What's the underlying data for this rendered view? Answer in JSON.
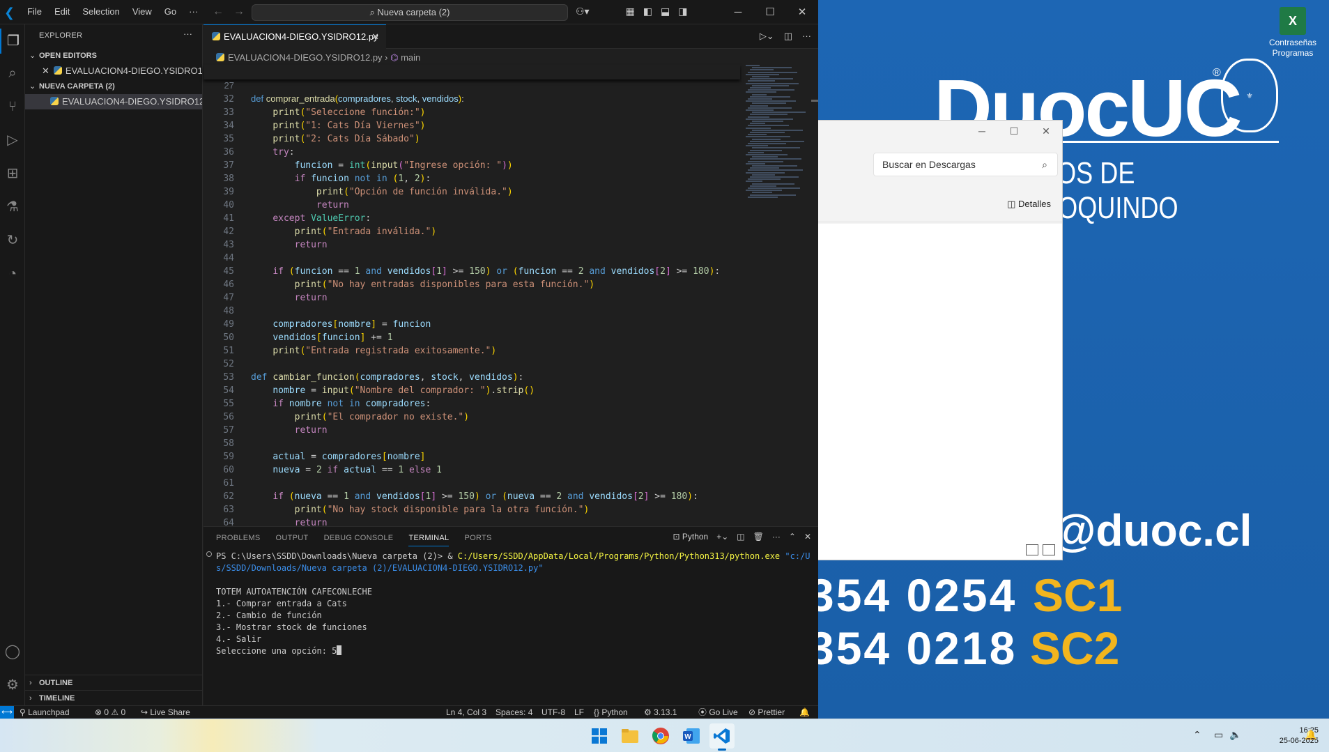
{
  "desktop": {
    "logo_text": "DuocUC",
    "subtitle": "RLOS DE APOQUINDO",
    "email": "@duoc.cl",
    "phone1": "354 0254",
    "code1": "SC1",
    "phone2": "354 0218",
    "code2": "SC2",
    "icon_label": "Contraseñas Programas",
    "icon_name": "excel-file-icon"
  },
  "file_explorer": {
    "search_placeholder": "Buscar en Descargas",
    "details_label": "Detalles"
  },
  "vscode": {
    "menu": [
      "File",
      "Edit",
      "Selection",
      "View",
      "Go",
      "···"
    ],
    "command_center": "Nueva carpeta (2)",
    "explorer_title": "EXPLORER",
    "open_editors_label": "OPEN EDITORS",
    "open_editor_file": "EVALUACION4-DIEGO.YSIDRO12.py",
    "folder_label": "NUEVA CARPETA (2)",
    "folder_file": "EVALUACION4-DIEGO.YSIDRO12.py",
    "outline_label": "OUTLINE",
    "timeline_label": "TIMELINE",
    "tab_label": "EVALUACION4-DIEGO.YSIDRO12.py",
    "breadcrumb_file": "EVALUACION4-DIEGO.YSIDRO12.py",
    "breadcrumb_symbol": "main",
    "sticky_line": {
      "n": "27",
      "html": "<span class='kw2'>def</span> <span class='fn'>comprar_entrada</span><span class='br'>(</span><span class='vr'>compradores</span>, <span class='vr'>stock</span>, <span class='vr'>vendidos</span><span class='br'>)</span>:"
    },
    "code_lines": [
      {
        "n": "32",
        "html": ""
      },
      {
        "n": "33",
        "html": "    <span class='fn'>print</span><span class='br'>(</span><span class='st'>\"Seleccione función:\"</span><span class='br'>)</span>"
      },
      {
        "n": "34",
        "html": "    <span class='fn'>print</span><span class='br'>(</span><span class='st'>\"1: Cats Día Viernes\"</span><span class='br'>)</span>"
      },
      {
        "n": "35",
        "html": "    <span class='fn'>print</span><span class='br'>(</span><span class='st'>\"2: Cats Día Sábado\"</span><span class='br'>)</span>"
      },
      {
        "n": "36",
        "html": "    <span class='kw'>try</span>:"
      },
      {
        "n": "37",
        "html": "        <span class='vr'>funcion</span> = <span class='ty'>int</span><span class='br'>(</span><span class='fn'>input</span><span class='br2'>(</span><span class='st'>\"Ingrese opción: \"</span><span class='br2'>)</span><span class='br'>)</span>"
      },
      {
        "n": "38",
        "html": "        <span class='kw'>if</span> <span class='vr'>funcion</span> <span class='kw2'>not in</span> <span class='br'>(</span><span class='nm'>1</span>, <span class='nm'>2</span><span class='br'>)</span>:"
      },
      {
        "n": "39",
        "html": "            <span class='fn'>print</span><span class='br'>(</span><span class='st'>\"Opción de función inválida.\"</span><span class='br'>)</span>"
      },
      {
        "n": "40",
        "html": "            <span class='kw'>return</span>"
      },
      {
        "n": "41",
        "html": "    <span class='kw'>except</span> <span class='ty'>ValueError</span>:"
      },
      {
        "n": "42",
        "html": "        <span class='fn'>print</span><span class='br'>(</span><span class='st'>\"Entrada inválida.\"</span><span class='br'>)</span>"
      },
      {
        "n": "43",
        "html": "        <span class='kw'>return</span>"
      },
      {
        "n": "44",
        "html": ""
      },
      {
        "n": "45",
        "html": "    <span class='kw'>if</span> <span class='br'>(</span><span class='vr'>funcion</span> == <span class='nm'>1</span> <span class='kw2'>and</span> <span class='vr'>vendidos</span><span class='br2'>[</span><span class='nm'>1</span><span class='br2'>]</span> >= <span class='nm'>150</span><span class='br'>)</span> <span class='kw2'>or</span> <span class='br'>(</span><span class='vr'>funcion</span> == <span class='nm'>2</span> <span class='kw2'>and</span> <span class='vr'>vendidos</span><span class='br2'>[</span><span class='nm'>2</span><span class='br2'>]</span> >= <span class='nm'>180</span><span class='br'>)</span>:"
      },
      {
        "n": "46",
        "html": "        <span class='fn'>print</span><span class='br'>(</span><span class='st'>\"No hay entradas disponibles para esta función.\"</span><span class='br'>)</span>"
      },
      {
        "n": "47",
        "html": "        <span class='kw'>return</span>"
      },
      {
        "n": "48",
        "html": ""
      },
      {
        "n": "49",
        "html": "    <span class='vr'>compradores</span><span class='br'>[</span><span class='vr'>nombre</span><span class='br'>]</span> = <span class='vr'>funcion</span>"
      },
      {
        "n": "50",
        "html": "    <span class='vr'>vendidos</span><span class='br'>[</span><span class='vr'>funcion</span><span class='br'>]</span> += <span class='nm'>1</span>"
      },
      {
        "n": "51",
        "html": "    <span class='fn'>print</span><span class='br'>(</span><span class='st'>\"Entrada registrada exitosamente.\"</span><span class='br'>)</span>"
      },
      {
        "n": "52",
        "html": ""
      },
      {
        "n": "53",
        "html": "<span class='kw2'>def</span> <span class='fn'>cambiar_funcion</span><span class='br'>(</span><span class='vr'>compradores</span>, <span class='vr'>stock</span>, <span class='vr'>vendidos</span><span class='br'>)</span>:"
      },
      {
        "n": "54",
        "html": "    <span class='vr'>nombre</span> = <span class='fn'>input</span><span class='br'>(</span><span class='st'>\"Nombre del comprador: \"</span><span class='br'>)</span>.<span class='fn'>strip</span><span class='br'>()</span>"
      },
      {
        "n": "55",
        "html": "    <span class='kw'>if</span> <span class='vr'>nombre</span> <span class='kw2'>not in</span> <span class='vr'>compradores</span>:"
      },
      {
        "n": "56",
        "html": "        <span class='fn'>print</span><span class='br'>(</span><span class='st'>\"El comprador no existe.\"</span><span class='br'>)</span>"
      },
      {
        "n": "57",
        "html": "        <span class='kw'>return</span>"
      },
      {
        "n": "58",
        "html": ""
      },
      {
        "n": "59",
        "html": "    <span class='vr'>actual</span> = <span class='vr'>compradores</span><span class='br'>[</span><span class='vr'>nombre</span><span class='br'>]</span>"
      },
      {
        "n": "60",
        "html": "    <span class='vr'>nueva</span> = <span class='nm'>2</span> <span class='kw'>if</span> <span class='vr'>actual</span> == <span class='nm'>1</span> <span class='kw'>else</span> <span class='nm'>1</span>"
      },
      {
        "n": "61",
        "html": ""
      },
      {
        "n": "62",
        "html": "    <span class='kw'>if</span> <span class='br'>(</span><span class='vr'>nueva</span> == <span class='nm'>1</span> <span class='kw2'>and</span> <span class='vr'>vendidos</span><span class='br2'>[</span><span class='nm'>1</span><span class='br2'>]</span> >= <span class='nm'>150</span><span class='br'>)</span> <span class='kw2'>or</span> <span class='br'>(</span><span class='vr'>nueva</span> == <span class='nm'>2</span> <span class='kw2'>and</span> <span class='vr'>vendidos</span><span class='br2'>[</span><span class='nm'>2</span><span class='br2'>]</span> >= <span class='nm'>180</span><span class='br'>)</span>:"
      },
      {
        "n": "63",
        "html": "        <span class='fn'>print</span><span class='br'>(</span><span class='st'>\"No hay stock disponible para la otra función.\"</span><span class='br'>)</span>"
      },
      {
        "n": "64",
        "html": "        <span class='kw'>return</span>"
      },
      {
        "n": "65",
        "html": ""
      }
    ],
    "panel_tabs": [
      "PROBLEMS",
      "OUTPUT",
      "DEBUG CONSOLE",
      "TERMINAL",
      "PORTS"
    ],
    "active_panel_tab": "TERMINAL",
    "terminal_profile": "Python",
    "terminal_lines": [
      "PS C:\\Users\\SSDD\\Downloads\\Nueva carpeta (2)> & C:/Users/SSDD/AppData/Local/Programs/Python/Python313/python.exe \"c:/User",
      "s/SSDD/Downloads/Nueva carpeta (2)/EVALUACION4-DIEGO.YSIDRO12.py\"",
      "",
      "TOTEM AUTOATENCIÓN CAFECONLECHE",
      "1.- Comprar entrada a Cats",
      "2.- Cambio de función",
      "3.- Mostrar stock de funciones",
      "4.- Salir"
    ],
    "terminal_prompt": "Seleccione una opción: ",
    "terminal_input": "5",
    "status": {
      "launchpad": "Launchpad",
      "errors": "0",
      "warnings": "0",
      "live_share": "Live Share",
      "position": "Ln 4, Col 3",
      "spaces": "Spaces: 4",
      "encoding": "UTF-8",
      "eol": "LF",
      "language": "Python",
      "version": "3.13.1",
      "go_live": "Go Live",
      "prettier": "Prettier"
    }
  },
  "taskbar": {
    "apps": [
      "windows-start",
      "file-explorer",
      "chrome",
      "word",
      "vscode"
    ],
    "time": "16:25",
    "date": "25-06-2025"
  }
}
